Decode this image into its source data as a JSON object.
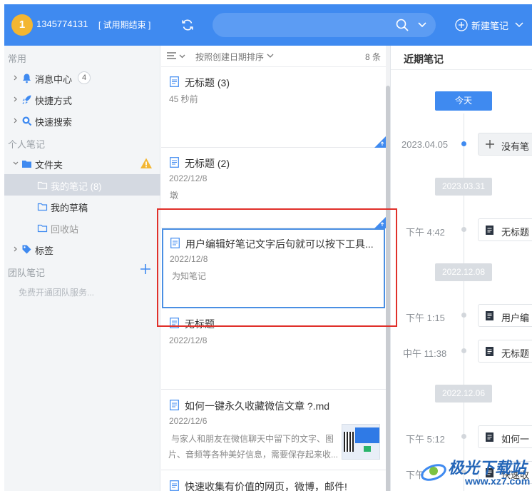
{
  "topbar": {
    "avatar_label": "1",
    "account": "1345774131",
    "trial_status": "[ 试用期结束 ]",
    "new_note_label": "新建笔记",
    "accent": "#3f8af0"
  },
  "sidebar": {
    "section_common": "常用",
    "messages": "消息中心",
    "messages_count": "4",
    "shortcuts": "快捷方式",
    "quick_search": "快速搜索",
    "section_personal": "个人笔记",
    "folders": "文件夹",
    "my_notes": "我的笔记 (8)",
    "my_drafts": "我的草稿",
    "recycle": "回收站",
    "tags": "标签",
    "section_team": "团队笔记",
    "team_free": "免费开通团队服务..."
  },
  "list": {
    "sort_label": "按照创建日期排序",
    "count": "8 条",
    "notes": [
      {
        "title": "无标题 (3)",
        "date": "45 秒前",
        "snippet": ""
      },
      {
        "title": "无标题 (2)",
        "date": "2022/12/8",
        "snippet": "墩"
      },
      {
        "title": "用户编辑好笔记文字后句就可以按下工具...",
        "date": "2022/12/8",
        "snippet": "为知笔记"
      },
      {
        "title": "无标题",
        "date": "2022/12/8",
        "snippet": ""
      },
      {
        "title": "如何一键永久收藏微信文章 ?.md",
        "date": "2022/12/6",
        "snippet1": "与家人和朋友在微信聊天中留下的文字、图",
        "snippet2": "片、音频等各种美好信息，需要保存起来收..."
      },
      {
        "title": "快速收集有价值的网页，微博，邮件!",
        "date": "",
        "snippet": ""
      }
    ]
  },
  "timeline": {
    "title": "近期笔记",
    "today": "今天",
    "entries": [
      {
        "time": "2023.04.05",
        "card": "没有笔"
      },
      {
        "pill": "2023.03.31"
      },
      {
        "time": "下午 4:42",
        "card": "无标题"
      },
      {
        "pill": "2022.12.08"
      },
      {
        "time": "下午 1:15",
        "card": "用户编"
      },
      {
        "time": "中午 11:38",
        "card": "无标题"
      },
      {
        "pill": "2022.12.06"
      },
      {
        "time": "下午 5:12",
        "card": "如何一"
      },
      {
        "time": "下午",
        "card": "快速收"
      }
    ]
  },
  "watermark": {
    "text": "极光下载站",
    "sub": "www.xz7.com"
  }
}
